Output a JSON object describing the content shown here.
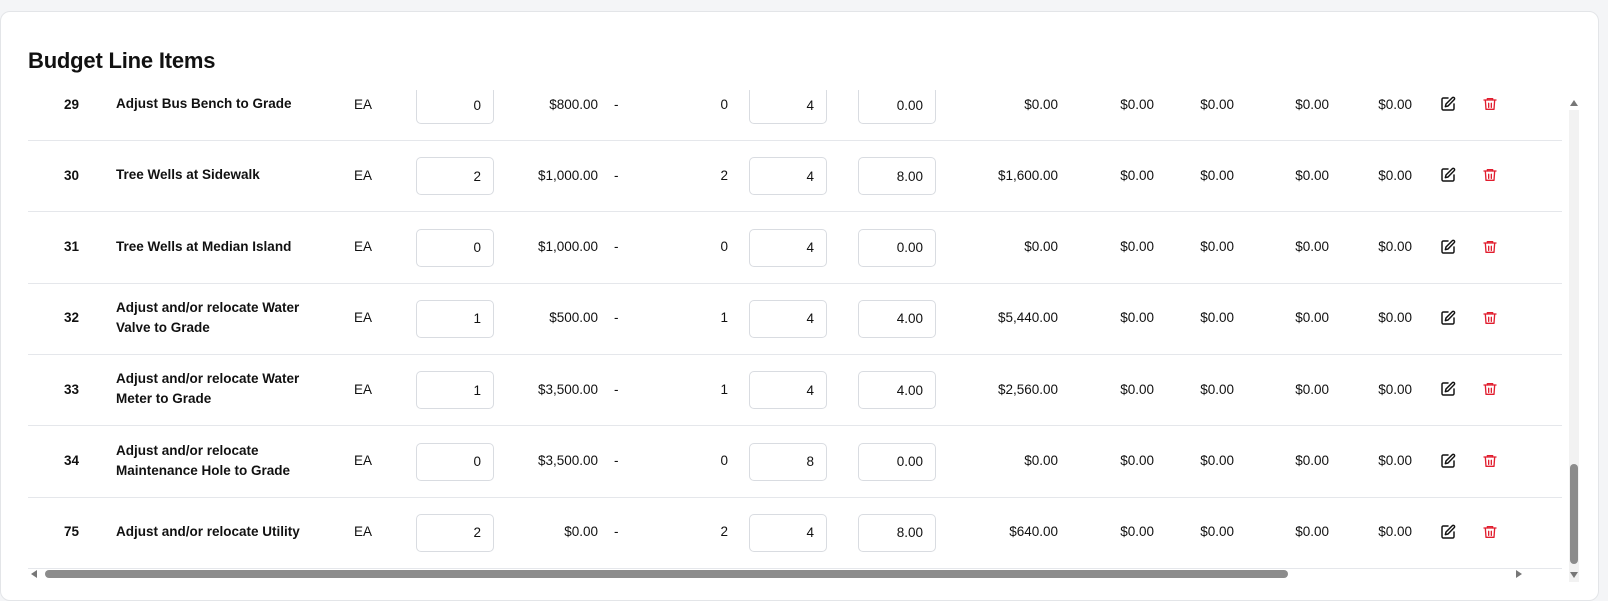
{
  "title": "Budget Line Items",
  "icons": {
    "edit": "edit-icon",
    "delete": "trash-icon",
    "delete_color": "#e11d2e"
  },
  "rows": [
    {
      "no": "29",
      "desc": "Adjust Bus Bench to Grade",
      "unit": "EA",
      "qty_input": "0",
      "unit_price": "$800.00",
      "dash": "-",
      "qty": "0",
      "input2": "4",
      "input3": "0.00",
      "amt1": "$0.00",
      "amt2": "$0.00",
      "amt3": "$0.00",
      "amt4": "$0.00",
      "amt5": "$0.00"
    },
    {
      "no": "30",
      "desc": "Tree Wells at Sidewalk",
      "unit": "EA",
      "qty_input": "2",
      "unit_price": "$1,000.00",
      "dash": "-",
      "qty": "2",
      "input2": "4",
      "input3": "8.00",
      "amt1": "$1,600.00",
      "amt2": "$0.00",
      "amt3": "$0.00",
      "amt4": "$0.00",
      "amt5": "$0.00"
    },
    {
      "no": "31",
      "desc": "Tree Wells at Median Island",
      "unit": "EA",
      "qty_input": "0",
      "unit_price": "$1,000.00",
      "dash": "-",
      "qty": "0",
      "input2": "4",
      "input3": "0.00",
      "amt1": "$0.00",
      "amt2": "$0.00",
      "amt3": "$0.00",
      "amt4": "$0.00",
      "amt5": "$0.00"
    },
    {
      "no": "32",
      "desc": "Adjust and/or relocate Water Valve to Grade",
      "unit": "EA",
      "qty_input": "1",
      "unit_price": "$500.00",
      "dash": "-",
      "qty": "1",
      "input2": "4",
      "input3": "4.00",
      "amt1": "$5,440.00",
      "amt2": "$0.00",
      "amt3": "$0.00",
      "amt4": "$0.00",
      "amt5": "$0.00"
    },
    {
      "no": "33",
      "desc": "Adjust and/or relocate Water Meter to Grade",
      "unit": "EA",
      "qty_input": "1",
      "unit_price": "$3,500.00",
      "dash": "-",
      "qty": "1",
      "input2": "4",
      "input3": "4.00",
      "amt1": "$2,560.00",
      "amt2": "$0.00",
      "amt3": "$0.00",
      "amt4": "$0.00",
      "amt5": "$0.00"
    },
    {
      "no": "34",
      "desc": "Adjust and/or relocate Maintenance Hole to Grade",
      "unit": "EA",
      "qty_input": "0",
      "unit_price": "$3,500.00",
      "dash": "-",
      "qty": "0",
      "input2": "8",
      "input3": "0.00",
      "amt1": "$0.00",
      "amt2": "$0.00",
      "amt3": "$0.00",
      "amt4": "$0.00",
      "amt5": "$0.00"
    },
    {
      "no": "75",
      "desc": "Adjust and/or relocate Utility",
      "unit": "EA",
      "qty_input": "2",
      "unit_price": "$0.00",
      "dash": "-",
      "qty": "2",
      "input2": "4",
      "input3": "8.00",
      "amt1": "$640.00",
      "amt2": "$0.00",
      "amt3": "$0.00",
      "amt4": "$0.00",
      "amt5": "$0.00"
    }
  ]
}
